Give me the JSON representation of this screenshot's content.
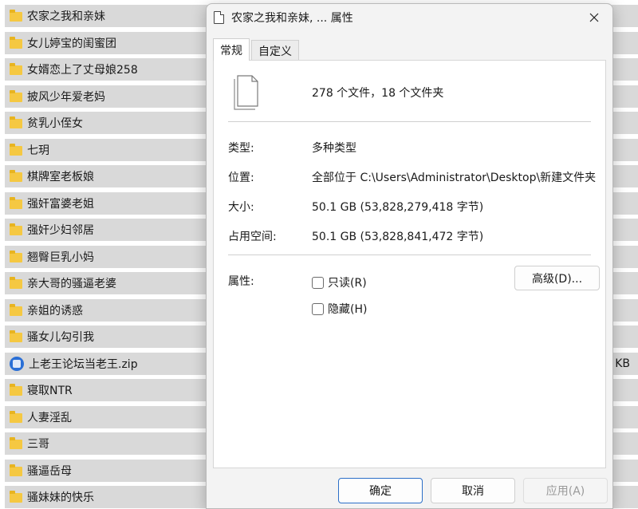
{
  "explorer": {
    "items": [
      {
        "name": "农家之我和亲妹",
        "icon": "folder-icon"
      },
      {
        "name": "女儿婷宝的闺蜜团",
        "icon": "folder-icon"
      },
      {
        "name": "女婿恋上了丈母娘258",
        "icon": "folder-icon"
      },
      {
        "name": "披风少年爱老妈",
        "icon": "folder-icon"
      },
      {
        "name": "贫乳小侄女",
        "icon": "folder-icon"
      },
      {
        "name": "七玥",
        "icon": "folder-icon"
      },
      {
        "name": "棋牌室老板娘",
        "icon": "folder-icon"
      },
      {
        "name": "强奸富婆老姐",
        "icon": "folder-icon"
      },
      {
        "name": "强奸少妇邻居",
        "icon": "folder-icon"
      },
      {
        "name": "翘臀巨乳小妈",
        "icon": "folder-icon"
      },
      {
        "name": "亲大哥的骚逼老婆",
        "icon": "folder-icon"
      },
      {
        "name": "亲姐的诱惑",
        "icon": "folder-icon"
      },
      {
        "name": "骚女儿勾引我",
        "icon": "folder-icon"
      },
      {
        "name": "上老王论坛当老王.zip",
        "icon": "zip-icon"
      },
      {
        "name": "寝取NTR",
        "icon": "folder-icon"
      },
      {
        "name": "人妻淫乱",
        "icon": "folder-icon"
      },
      {
        "name": "三哥",
        "icon": "folder-icon"
      },
      {
        "name": "骚逼岳母",
        "icon": "folder-icon"
      },
      {
        "name": "骚妹妹的快乐",
        "icon": "folder-icon"
      }
    ],
    "zip_size_suffix": "KB"
  },
  "dialog": {
    "title": "农家之我和亲妹, ... 属性",
    "tabs": [
      "常规",
      "自定义"
    ],
    "summary": "278 个文件，18 个文件夹",
    "properties": [
      {
        "label": "类型:",
        "value": "多种类型"
      },
      {
        "label": "位置:",
        "value": "全部位于 C:\\Users\\Administrator\\Desktop\\新建文件夹"
      },
      {
        "label": "大小:",
        "value": "50.1 GB (53,828,279,418 字节)"
      },
      {
        "label": "占用空间:",
        "value": "50.1 GB (53,828,841,472 字节)"
      }
    ],
    "attributes_label": "属性:",
    "readonly_label": "只读(R)",
    "hidden_label": "隐藏(H)",
    "advanced_label": "高级(D)...",
    "ok_label": "确定",
    "cancel_label": "取消",
    "apply_label": "应用(A)"
  },
  "colors": {
    "accent": "#2c6fc8",
    "folder": "#f5c842",
    "row_bg": "#d9d9d9"
  }
}
